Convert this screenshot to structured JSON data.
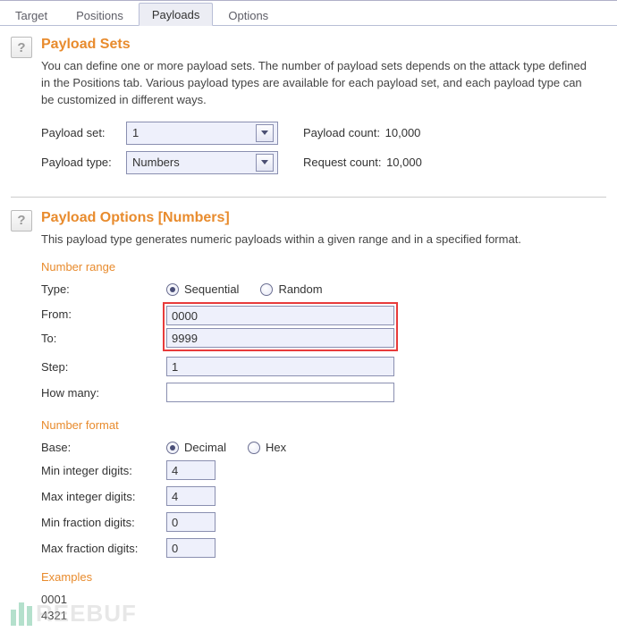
{
  "tabs": {
    "target": "Target",
    "positions": "Positions",
    "payloads": "Payloads",
    "options": "Options"
  },
  "payload_sets": {
    "title": "Payload Sets",
    "description": "You can define one or more payload sets. The number of payload sets depends on the attack type defined in the Positions tab. Various payload types are available for each payload set, and each payload type can be customized in different ways.",
    "payload_set_label": "Payload set:",
    "payload_set_value": "1",
    "payload_type_label": "Payload type:",
    "payload_type_value": "Numbers",
    "payload_count_label": "Payload count:",
    "payload_count_value": "10,000",
    "request_count_label": "Request count:",
    "request_count_value": "10,000",
    "help_glyph": "?"
  },
  "payload_options": {
    "title": "Payload Options [Numbers]",
    "description": "This payload type generates numeric payloads within a given range and in a specified format.",
    "help_glyph": "?",
    "number_range": {
      "heading": "Number range",
      "type_label": "Type:",
      "sequential_label": "Sequential",
      "random_label": "Random",
      "from_label": "From:",
      "from_value": "0000",
      "to_label": "To:",
      "to_value": "9999",
      "step_label": "Step:",
      "step_value": "1",
      "how_many_label": "How many:",
      "how_many_value": ""
    },
    "number_format": {
      "heading": "Number format",
      "base_label": "Base:",
      "decimal_label": "Decimal",
      "hex_label": "Hex",
      "min_int_label": "Min integer digits:",
      "min_int_value": "4",
      "max_int_label": "Max integer digits:",
      "max_int_value": "4",
      "min_frac_label": "Min fraction digits:",
      "min_frac_value": "0",
      "max_frac_label": "Max fraction digits:",
      "max_frac_value": "0"
    },
    "examples": {
      "heading": "Examples",
      "items": [
        "0001",
        "4321"
      ]
    }
  },
  "watermark": "REEBUF"
}
